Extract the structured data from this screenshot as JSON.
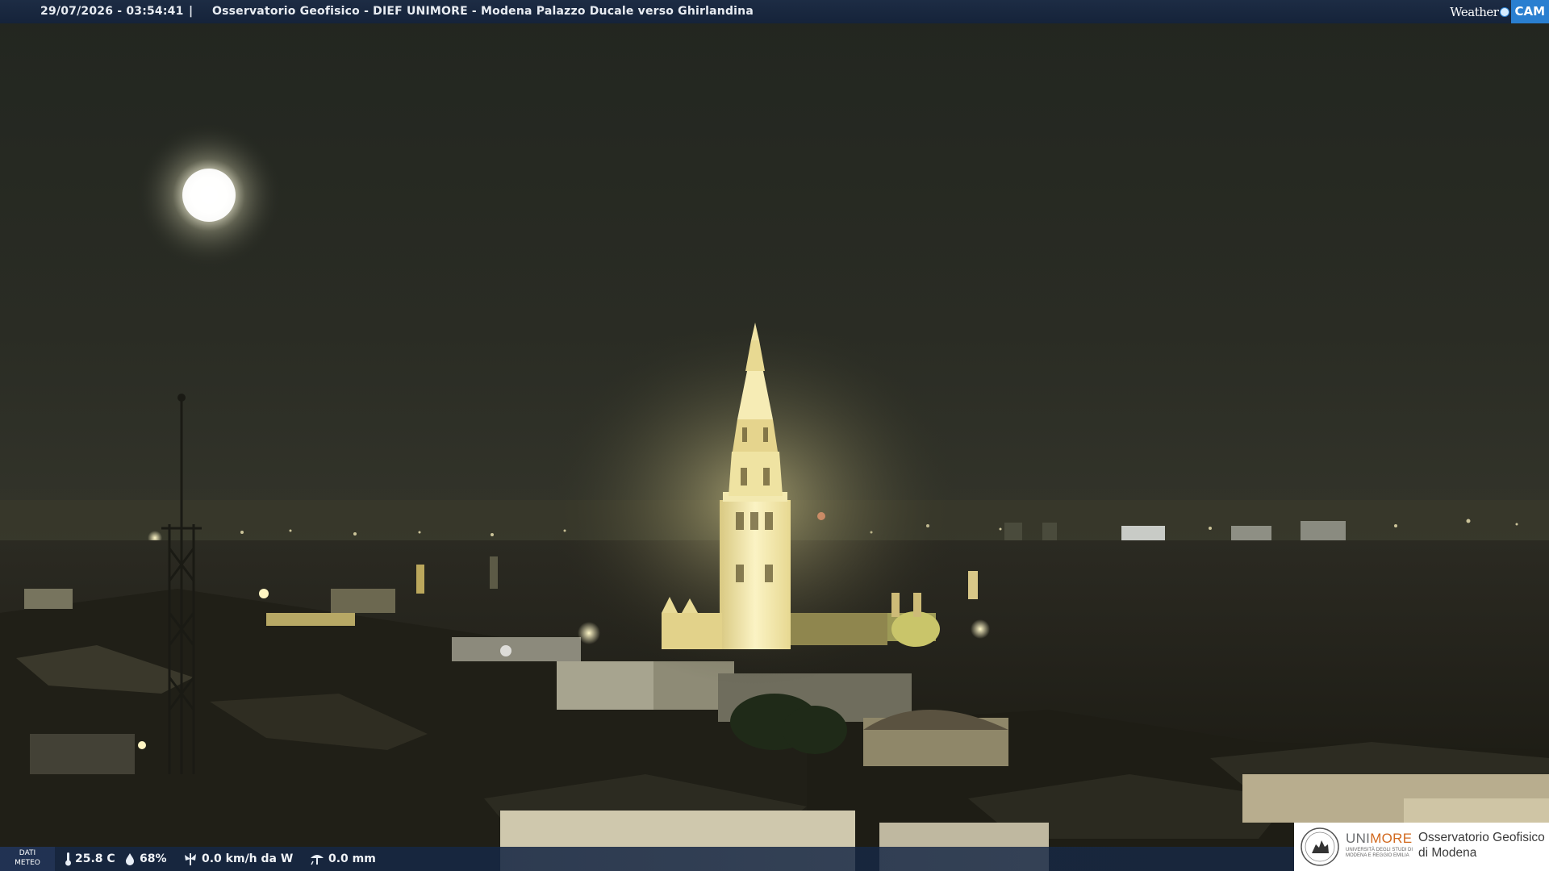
{
  "header": {
    "timestamp": "29/07/2026 - 03:54:41",
    "separator": "|",
    "title": "Osservatorio Geofisico - DIEF UNIMORE - Modena Palazzo Ducale verso Ghirlandina"
  },
  "brand": {
    "word1": "Weather",
    "word2": "CAM",
    "accent": "#2a7fd0"
  },
  "scene": {
    "subject": "night-view-modena-ghirlandina-tower",
    "sky_color": "#26281f",
    "tower_light_color": "#f3e9b0",
    "moon": "visible"
  },
  "weather": {
    "panel_label_1": "DATI",
    "panel_label_2": "METEO",
    "temperature": "25.8 C",
    "humidity": "68%",
    "wind": "0.0 km/h da W",
    "rain": "0.0 mm",
    "icons": [
      "thermometer-icon",
      "humidity-drop-icon",
      "wind-icon",
      "rain-gauge-icon"
    ]
  },
  "logo": {
    "uni_part1": "UNI",
    "uni_part2": "MORE",
    "uni_subline1": "UNIVERSITÀ DEGLI STUDI DI",
    "uni_subline2": "MODENA E REGGIO EMILIA",
    "observatory_line1": "Osservatorio Geofisico",
    "observatory_line2": "di Modena",
    "accent": "#d2691e"
  }
}
